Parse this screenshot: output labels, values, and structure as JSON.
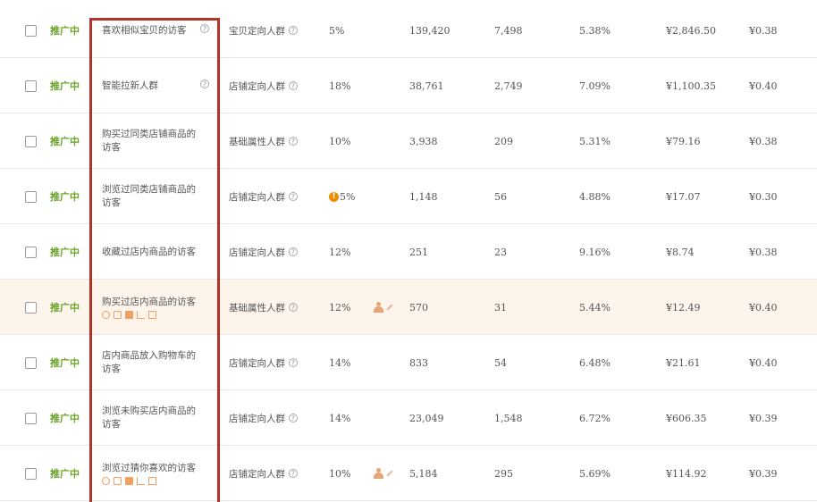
{
  "rows": [
    {
      "status": "推广中",
      "name_lines": [
        "喜欢相似宝贝的访客"
      ],
      "name_help": true,
      "type": "宝贝定向人群",
      "premium": "5%",
      "warn": false,
      "adjust": false,
      "impressions": "139,420",
      "clicks": "7,498",
      "ctr": "5.38%",
      "cost": "¥2,846.50",
      "ppc": "¥0.38",
      "highlight": false
    },
    {
      "status": "推广中",
      "name_lines": [
        "智能拉新人群"
      ],
      "name_help": true,
      "type": "店铺定向人群",
      "premium": "18%",
      "warn": false,
      "adjust": false,
      "impressions": "38,761",
      "clicks": "2,749",
      "ctr": "7.09%",
      "cost": "¥1,100.35",
      "ppc": "¥0.40",
      "highlight": false
    },
    {
      "status": "推广中",
      "name_lines": [
        "购买过同类店铺商品的",
        "访客"
      ],
      "name_help": false,
      "type": "基础属性人群",
      "premium": "10%",
      "warn": false,
      "adjust": false,
      "impressions": "3,938",
      "clicks": "209",
      "ctr": "5.31%",
      "cost": "¥79.16",
      "ppc": "¥0.38",
      "highlight": false
    },
    {
      "status": "推广中",
      "name_lines": [
        "浏览过同类店铺商品的",
        "访客"
      ],
      "name_help": false,
      "type": "店铺定向人群",
      "premium": "5%",
      "warn": true,
      "adjust": false,
      "impressions": "1,148",
      "clicks": "56",
      "ctr": "4.88%",
      "cost": "¥17.07",
      "ppc": "¥0.30",
      "highlight": false
    },
    {
      "status": "推广中",
      "name_lines": [
        "收藏过店内商品的访客"
      ],
      "name_help": false,
      "type": "店铺定向人群",
      "premium": "12%",
      "warn": false,
      "adjust": false,
      "impressions": "251",
      "clicks": "23",
      "ctr": "9.16%",
      "cost": "¥8.74",
      "ppc": "¥0.38",
      "highlight": false
    },
    {
      "status": "推广中",
      "name_lines": [
        "购买过店内商品的访客"
      ],
      "name_help": false,
      "tools": true,
      "type": "基础属性人群",
      "premium": "12%",
      "warn": false,
      "adjust": true,
      "impressions": "570",
      "clicks": "31",
      "ctr": "5.44%",
      "cost": "¥12.49",
      "ppc": "¥0.40",
      "highlight": true
    },
    {
      "status": "推广中",
      "name_lines": [
        "店内商品放入购物车的",
        "访客"
      ],
      "name_help": false,
      "type": "店铺定向人群",
      "premium": "14%",
      "warn": false,
      "adjust": false,
      "impressions": "833",
      "clicks": "54",
      "ctr": "6.48%",
      "cost": "¥21.61",
      "ppc": "¥0.40",
      "highlight": false
    },
    {
      "status": "推广中",
      "name_lines": [
        "浏览未购买店内商品的",
        "访客"
      ],
      "name_help": false,
      "type": "店铺定向人群",
      "premium": "14%",
      "warn": false,
      "adjust": false,
      "impressions": "23,049",
      "clicks": "1,548",
      "ctr": "6.72%",
      "cost": "¥606.35",
      "ppc": "¥0.39",
      "highlight": false
    },
    {
      "status": "推广中",
      "name_lines": [
        "浏览过猜你喜欢的访客"
      ],
      "name_help": false,
      "tools": true,
      "type": "店铺定向人群",
      "premium": "10%",
      "warn": false,
      "adjust": true,
      "impressions": "5,184",
      "clicks": "295",
      "ctr": "5.69%",
      "cost": "¥114.92",
      "ppc": "¥0.39",
      "highlight": false
    }
  ],
  "colors": {
    "status_green": "#6aa42a",
    "annotation_frame": "#b5322a",
    "highlight_row": "#fdf5ec"
  }
}
